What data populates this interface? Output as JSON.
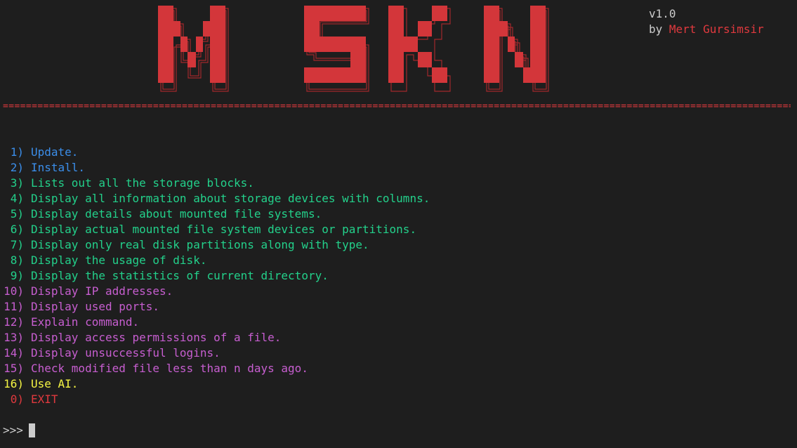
{
  "banner": {
    "logo_text": "MSKN",
    "version": "v1.0",
    "author_prefix": "by ",
    "author_name": "Mert Gursimsir",
    "separator": "=================================================================================================================================================",
    "colors": {
      "logo": "#d3363a",
      "logo_shadow": "#b02a2e"
    }
  },
  "menu": {
    "items": [
      {
        "num": "1)",
        "label": "Update.",
        "color": "blue"
      },
      {
        "num": "2)",
        "label": "Install.",
        "color": "blue"
      },
      {
        "num": "3)",
        "label": "Lists out all the storage blocks.",
        "color": "green"
      },
      {
        "num": "4)",
        "label": "Display all information about storage devices with columns.",
        "color": "green"
      },
      {
        "num": "5)",
        "label": "Display details about mounted file systems.",
        "color": "green"
      },
      {
        "num": "6)",
        "label": "Display actual mounted file system devices or partitions.",
        "color": "green"
      },
      {
        "num": "7)",
        "label": "Display only real disk partitions along with type.",
        "color": "green"
      },
      {
        "num": "8)",
        "label": "Display the usage of disk.",
        "color": "green"
      },
      {
        "num": "9)",
        "label": "Display the statistics of current directory.",
        "color": "green"
      },
      {
        "num": "10)",
        "label": "Display IP addresses.",
        "color": "magenta"
      },
      {
        "num": "11)",
        "label": "Display used ports.",
        "color": "magenta"
      },
      {
        "num": "12)",
        "label": "Explain command.",
        "color": "magenta"
      },
      {
        "num": "13)",
        "label": "Display access permissions of a file.",
        "color": "magenta"
      },
      {
        "num": "14)",
        "label": "Display unsuccessful logins.",
        "color": "magenta"
      },
      {
        "num": "15)",
        "label": "Check modified file less than n days ago.",
        "color": "magenta"
      },
      {
        "num": "16)",
        "label": "Use AI.",
        "color": "yellow"
      },
      {
        "num": "0)",
        "label": "EXIT",
        "color": "red"
      }
    ]
  },
  "prompt": {
    "symbol": ">>>",
    "input_value": ""
  },
  "colors": {
    "background": "#1e1e1e",
    "foreground": "#cccccc",
    "blue": "#3b8eea",
    "green": "#23d18b",
    "magenta": "#c75ed0",
    "yellow": "#f5f543",
    "red": "#e0393e"
  }
}
